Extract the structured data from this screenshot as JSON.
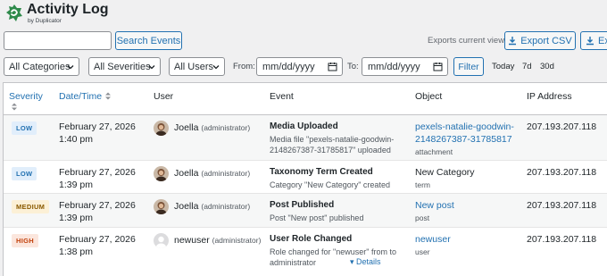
{
  "header": {
    "title": "Activity Log",
    "subtitle": "by Duplicator",
    "brand_color": "#2e8a4b"
  },
  "toolbar": {
    "search_placeholder": "",
    "search_button": "Search Events",
    "exports_label": "Exports current view",
    "export_csv": "Export CSV",
    "export_second": "Ex"
  },
  "filters": {
    "categories": "All Categories",
    "severities": "All Severities",
    "users": "All Users",
    "from_label": "From:",
    "from_value": "mm/dd/yyyy",
    "to_label": "To:",
    "to_value": "mm/dd/yyyy",
    "filter_button": "Filter",
    "quick": [
      "Today",
      "7d",
      "30d"
    ]
  },
  "table": {
    "columns": [
      "Severity",
      "Date/Time",
      "User",
      "Event",
      "Object",
      "IP Address"
    ],
    "rows": [
      {
        "severity": "LOW",
        "date": "February 27, 2026",
        "time": "1:40 pm",
        "user": "Joella",
        "role": "(administrator)",
        "event_title": "Media Uploaded",
        "event_desc": "Media file \"pexels-natalie-goodwin-2148267387-31785817\" uploaded",
        "object_line1": "pexels-natalie-goodwin-",
        "object_line2": "2148267387-31785817",
        "object_type": "attachment",
        "ip": "207.193.207.118"
      },
      {
        "severity": "LOW",
        "date": "February 27, 2026",
        "time": "1:39 pm",
        "user": "Joella",
        "role": "(administrator)",
        "event_title": "Taxonomy Term Created",
        "event_desc": "Category \"New Category\" created",
        "object_line1": "New Category",
        "object_type": "term",
        "ip": "207.193.207.118"
      },
      {
        "severity": "MEDIUM",
        "date": "February 27, 2026",
        "time": "1:39 pm",
        "user": "Joella",
        "role": "(administrator)",
        "event_title": "Post Published",
        "event_desc": "Post \"New post\" published",
        "object_line1": "New post",
        "object_type": "post",
        "ip": "207.193.207.118"
      },
      {
        "severity": "HIGH",
        "date": "February 27, 2026",
        "time": "1:38 pm",
        "user": "newuser",
        "role": "(administrator)",
        "event_title": "User Role Changed",
        "event_desc": "Role changed for \"newuser\" from to administrator",
        "details": "Details",
        "object_line1": "newuser",
        "object_type": "user",
        "ip": "207.193.207.118"
      }
    ]
  }
}
